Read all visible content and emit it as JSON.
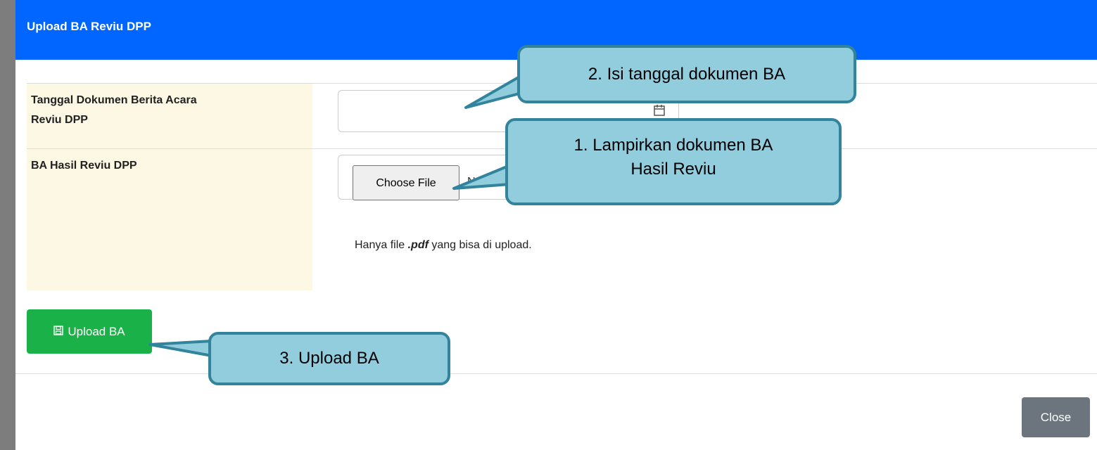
{
  "modal": {
    "title": "Upload BA Reviu DPP",
    "fields": {
      "date_label_line1": "Tanggal Dokumen Berita Acara",
      "date_label_line2": "Reviu DPP",
      "file_label": "BA Hasil Reviu DPP",
      "date_value": "",
      "choose_file_label": "Choose File",
      "no_file_text": "N",
      "hint_prefix": "Hanya file ",
      "hint_ext": ".pdf",
      "hint_suffix": " yang bisa di upload."
    },
    "upload_button": "Upload BA",
    "close_button": "Close"
  },
  "callouts": {
    "step2": "2.  Isi tanggal dokumen BA",
    "step1_line1": "1.  Lampirkan dokumen BA",
    "step1_line2": "Hasil Reviu",
    "step3": "3.  Upload BA"
  },
  "colors": {
    "header": "#0066ff",
    "label_bg": "#fcf8e3",
    "upload_button": "#1ab248",
    "close_button": "#6c757d",
    "callout_fill": "#92cddd",
    "callout_border": "#31849b"
  },
  "icons": {
    "calendar": "calendar-icon",
    "save": "floppy-disk-icon"
  }
}
